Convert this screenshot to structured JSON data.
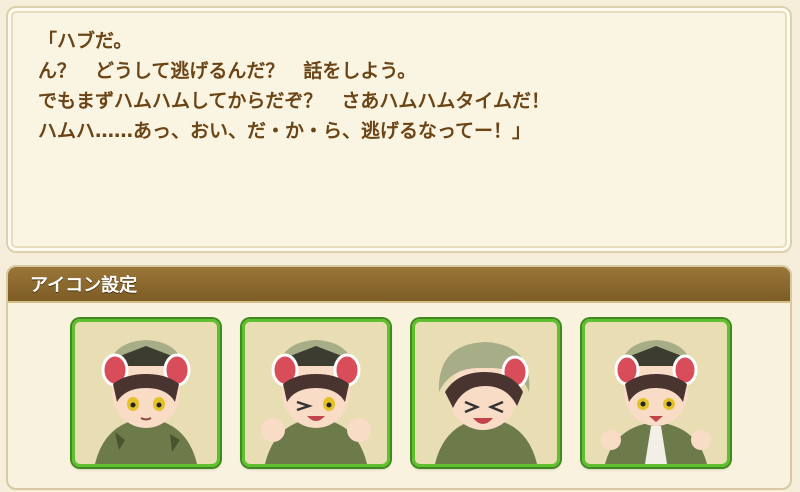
{
  "dialog": {
    "text": "「ハブだ。\nん？　どうして逃げるんだ？　話をしよう。\nでもまずハムハムしてからだぞ？　さあハムハムタイムだ！\nハムハ……あっ、おい、だ・か・ら、逃げるなってー！」"
  },
  "icon_settings": {
    "title": "アイコン設定",
    "icons": [
      {
        "name": "portrait-neutral-icon"
      },
      {
        "name": "portrait-happy-icon"
      },
      {
        "name": "portrait-laughing-icon"
      },
      {
        "name": "portrait-angry-icon"
      }
    ]
  },
  "colors": {
    "text": "#6b4516",
    "header": "#8a6a2e",
    "tile_border": "#5fbf2f"
  }
}
